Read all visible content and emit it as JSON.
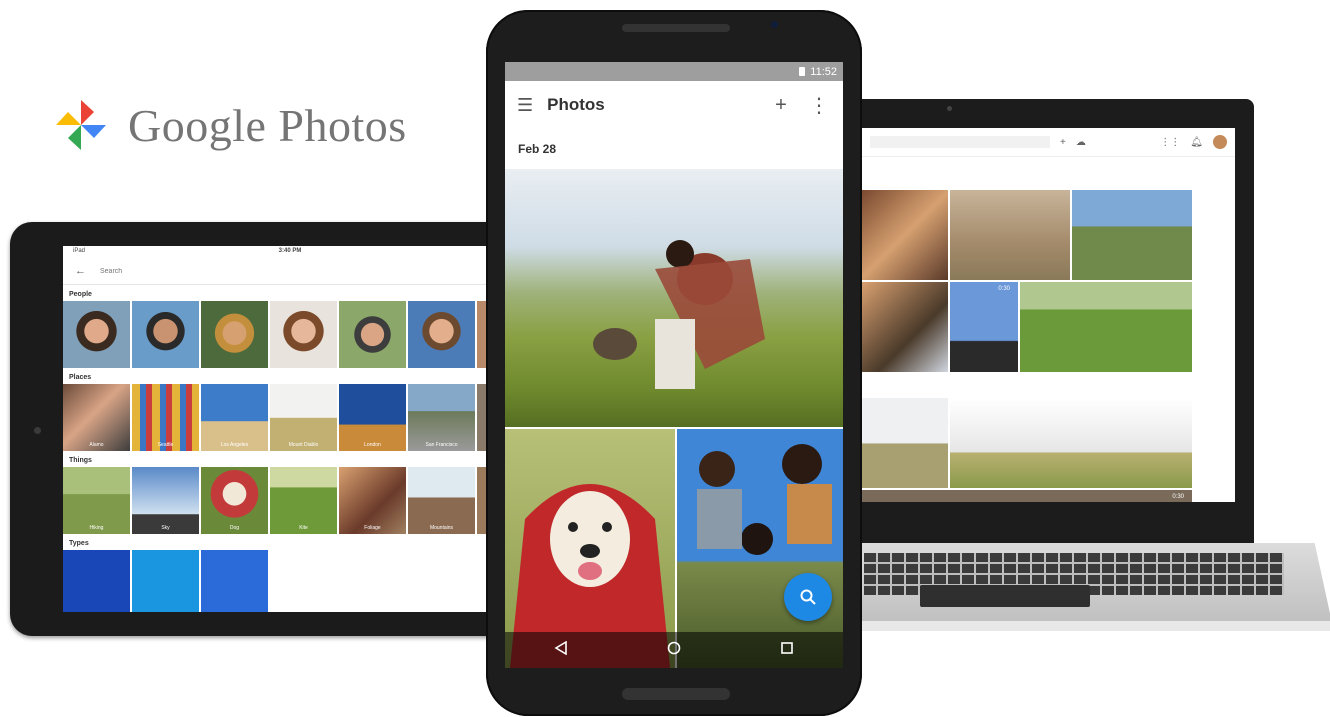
{
  "brand": {
    "name": "Google Photos",
    "logo_icon": "pinwheel-icon",
    "colors": [
      "#EA4335",
      "#FBBC05",
      "#34A853",
      "#4285F4"
    ]
  },
  "tablet": {
    "status_left": "iPad",
    "status_time": "3:40 PM",
    "search_placeholder": "Search",
    "sections": {
      "people": "People",
      "places": "Places",
      "things": "Things",
      "types": "Types"
    },
    "places_labels": [
      "Alamo",
      "Seattle",
      "Los Angeles",
      "Mount Diablo",
      "London",
      "San Francisco"
    ],
    "things_labels": [
      "Hiking",
      "Sky",
      "Dog",
      "Kite",
      "Foliage",
      "Mountains"
    ]
  },
  "phone": {
    "status_time": "11:52",
    "app_title": "Photos",
    "date_header": "Feb 28",
    "actions": {
      "menu_icon": "hamburger-menu-icon",
      "add_icon": "plus-icon",
      "more_icon": "more-vert-icon"
    },
    "fab_icon": "search-icon",
    "nav": [
      "back-icon",
      "home-icon",
      "recents-icon"
    ],
    "accent": "#1E88E5"
  },
  "laptop": {
    "video_duration": "0:30",
    "video_duration_2": "0:30"
  }
}
